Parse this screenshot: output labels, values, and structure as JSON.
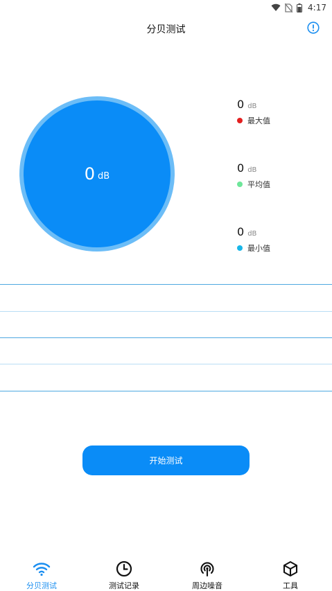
{
  "status_bar": {
    "time": "4:17"
  },
  "header": {
    "title": "分贝测试"
  },
  "gauge": {
    "value": "0",
    "unit": "dB"
  },
  "stats": [
    {
      "value": "0",
      "unit": "dB",
      "label": "最大值",
      "color": "#e32020"
    },
    {
      "value": "0",
      "unit": "dB",
      "label": "平均值",
      "color": "#6ee69a"
    },
    {
      "value": "0",
      "unit": "dB",
      "label": "最小值",
      "color": "#18b6e8"
    }
  ],
  "colors": {
    "accent": "#0a8cf7",
    "gauge_ring": "#6cbdf7",
    "line_dark": "#4ea8e0",
    "line_light": "#b9def5"
  },
  "start_button": {
    "label": "开始测试"
  },
  "bottom_nav": [
    {
      "label": "分贝测试",
      "icon": "wifi-icon",
      "active": true
    },
    {
      "label": "测试记录",
      "icon": "clock-icon",
      "active": false
    },
    {
      "label": "周边噪音",
      "icon": "broadcast-icon",
      "active": false
    },
    {
      "label": "工具",
      "icon": "cube-icon",
      "active": false
    }
  ]
}
